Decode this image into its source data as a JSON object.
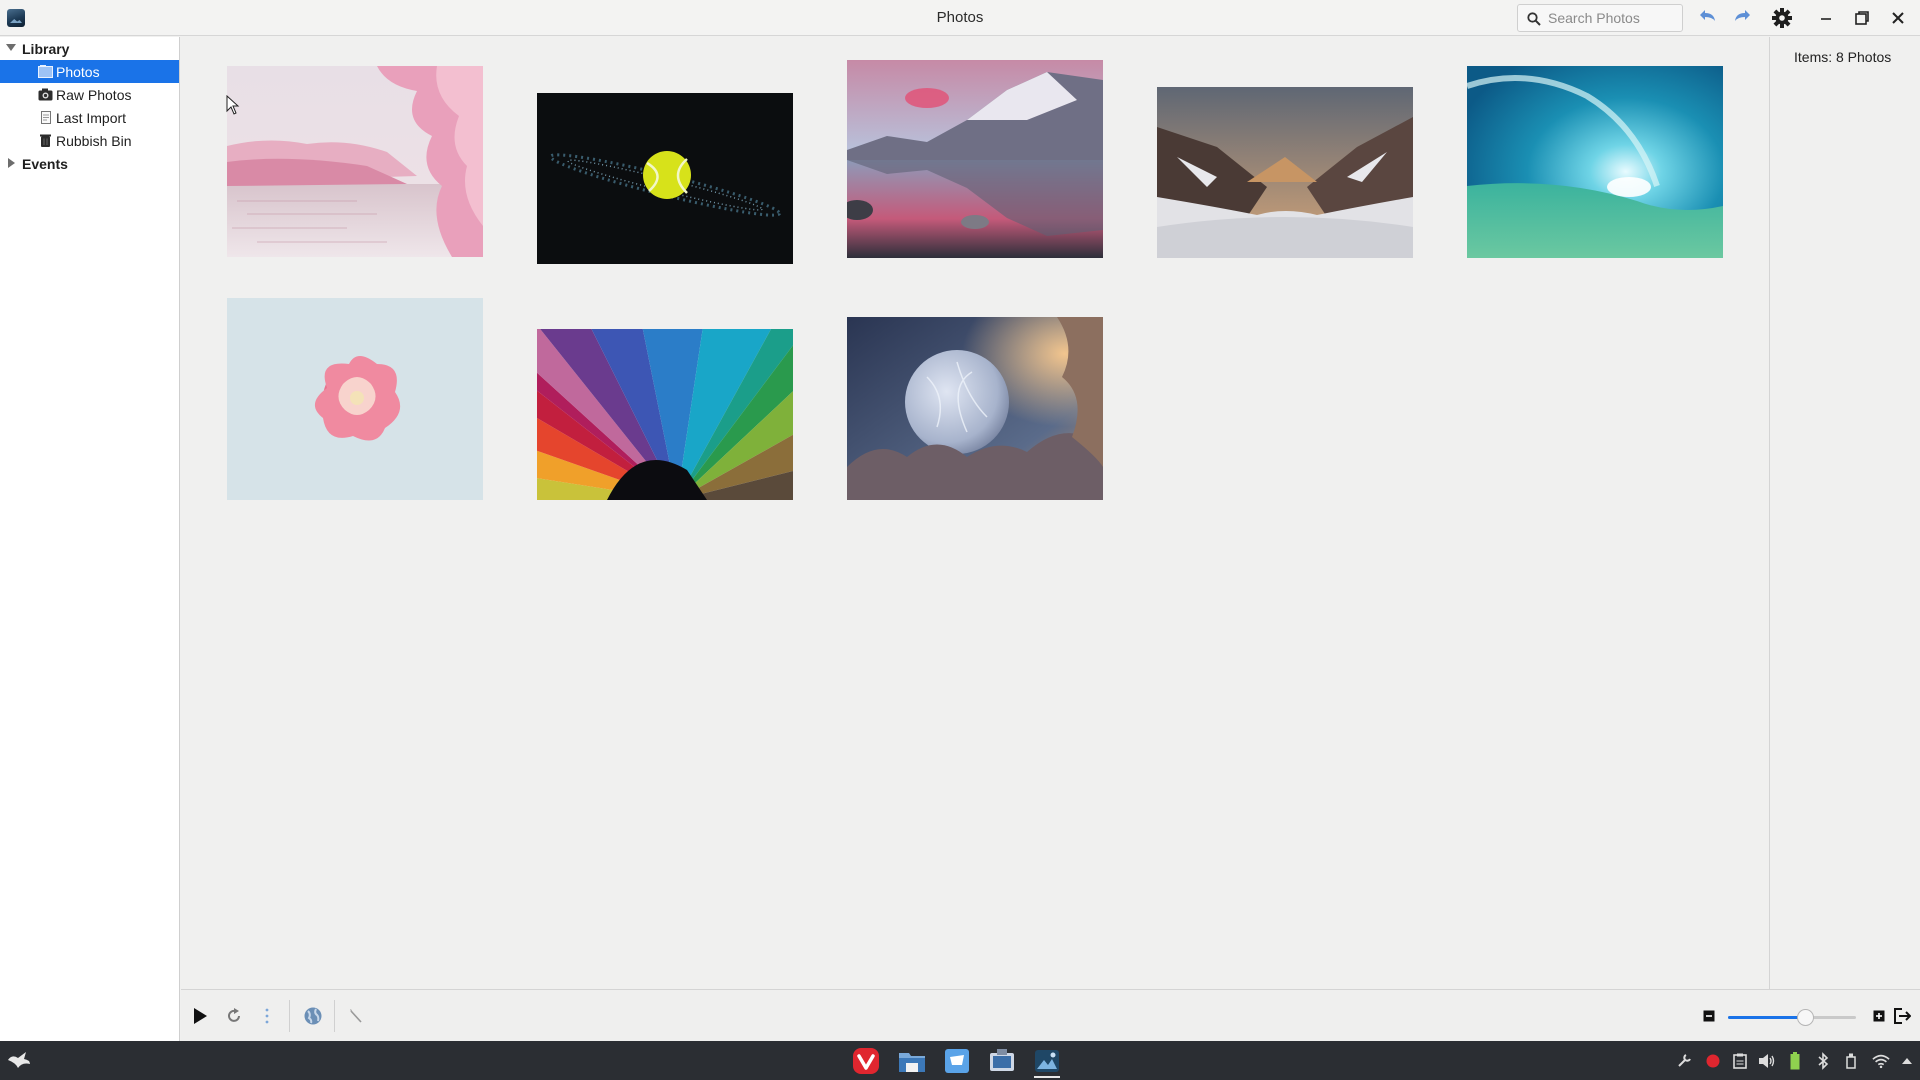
{
  "window": {
    "title": "Photos"
  },
  "search": {
    "placeholder": "Search Photos",
    "value": ""
  },
  "sidebar": {
    "library_label": "Library",
    "items": [
      {
        "label": "Photos",
        "icon": "photos-icon",
        "selected": true
      },
      {
        "label": "Raw Photos",
        "icon": "camera-icon",
        "selected": false
      },
      {
        "label": "Last Import",
        "icon": "import-icon",
        "selected": false
      },
      {
        "label": "Rubbish Bin",
        "icon": "trash-icon",
        "selected": false
      }
    ],
    "events_label": "Events"
  },
  "photos": [
    {
      "subject": "cherry blossoms by water"
    },
    {
      "subject": "tennis ball on black"
    },
    {
      "subject": "mountain lake at sunrise"
    },
    {
      "subject": "snowy mountain valley"
    },
    {
      "subject": "ocean wave"
    },
    {
      "subject": "pink flower on pale blue"
    },
    {
      "subject": "rainbow color fan"
    },
    {
      "subject": "frozen bubble"
    }
  ],
  "info": {
    "items_text": "Items:  8 Photos"
  },
  "zoom": {
    "level_fraction": 0.6
  },
  "colors": {
    "accent": "#1a73e8",
    "taskbar": "#2b2e33"
  }
}
